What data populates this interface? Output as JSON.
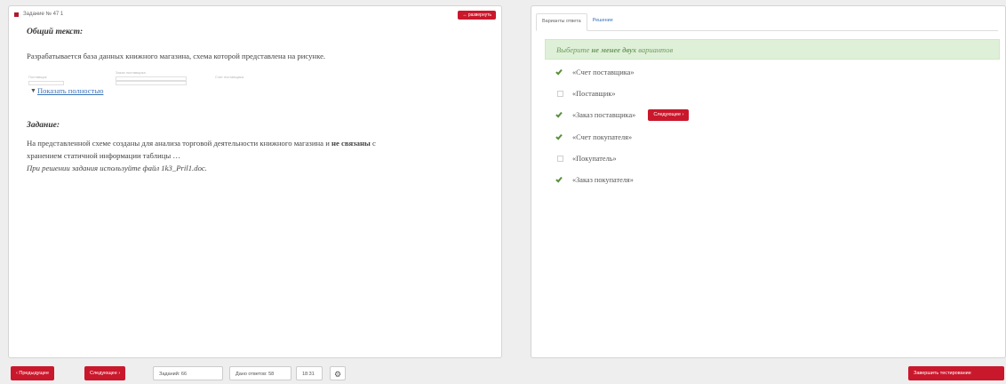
{
  "task": {
    "label": "Задание № 47 1",
    "expand_label": "↔ развернуть"
  },
  "common_text": {
    "title": "Общий текст:",
    "paragraph": "Разрабатывается база данных книжного магазина, схема которой представлена на рисунке.",
    "schema_labels": [
      "Поставщик",
      "Заказ поставщика",
      "Счет поставщика"
    ],
    "show_more": "Показать полностью"
  },
  "assignment": {
    "title": "Задание:",
    "line1_pre": "На представленной схеме созданы для анализа торговой деятельности книжного магазина и ",
    "line1_bold": "не связаны",
    "line1_post": " с",
    "line2": "хранением статичной информации таблицы …",
    "line3": "При решении задания используйте файл 1k3_Pril1.doc."
  },
  "answer_panel": {
    "tabs": [
      "Варианты ответа",
      "Решение"
    ],
    "hint_pre": "Выберите ",
    "hint_bold": "не менее двух",
    "hint_post": " вариантов",
    "options": [
      {
        "label": "«Счет поставщика»",
        "checked": true
      },
      {
        "label": "«Поставщик»",
        "checked": false
      },
      {
        "label": "«Заказ поставщика»",
        "checked": true
      },
      {
        "label": "«Счет покупателя»",
        "checked": true
      },
      {
        "label": "«Покупатель»",
        "checked": false
      },
      {
        "label": "«Заказ покупателя»",
        "checked": true
      }
    ],
    "next_inline_label": "Следующее ›"
  },
  "footer": {
    "prev_label": "‹ Предыдущее",
    "next_label": "Следующее ›",
    "tasks_count": "Заданий: 66",
    "answers_count": "Дано ответов: 58",
    "timer": "18:31",
    "finish_label": "Завершить тестирование"
  },
  "colors": {
    "accent_red": "#c9182c",
    "hint_bg": "#dff0d8",
    "check_green": "#5a8f3a",
    "link_blue": "#3a72b8"
  }
}
